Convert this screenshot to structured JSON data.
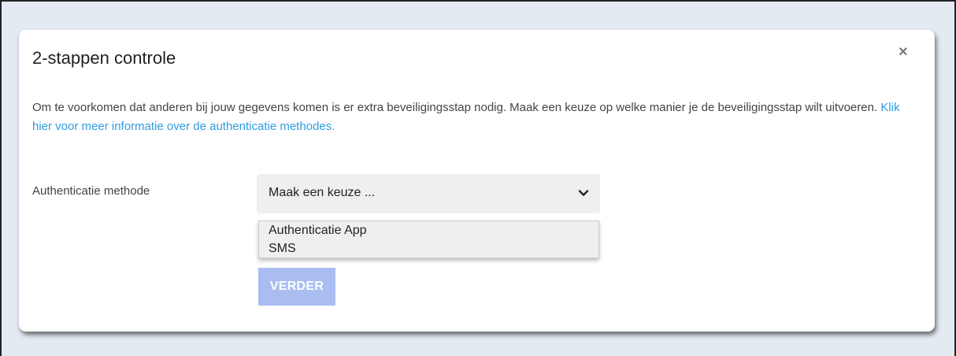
{
  "modal": {
    "title": "2-stappen controle",
    "close_icon": "close-icon",
    "close_label": "×",
    "description": "Om te voorkomen dat anderen bij jouw gegevens komen is er extra beveiligingsstap nodig. Maak een keuze op welke manier je de beveiligingsstap wilt uitvoeren.",
    "info_link": "Klik hier voor meer informatie over de authenticatie methodes."
  },
  "form": {
    "method_label": "Authenticatie methode",
    "select_value": "Maak een keuze ...",
    "options": [
      "Authenticatie App",
      "SMS"
    ],
    "submit_label": "VERDER"
  },
  "colors": {
    "background": "#e4eaf2",
    "link": "#2f9de0",
    "button_disabled": "#a9bdf0"
  }
}
